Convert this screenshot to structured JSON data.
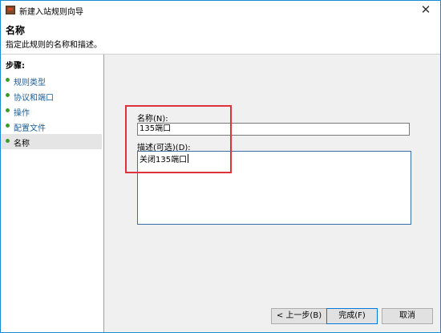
{
  "window": {
    "title": "新建入站规则向导",
    "close_symbol": "✕"
  },
  "header": {
    "title": "名称",
    "description": "指定此规则的名称和描述。"
  },
  "sidebar": {
    "steps_label": "步骤:",
    "items": [
      {
        "label": "规则类型"
      },
      {
        "label": "协议和端口"
      },
      {
        "label": "操作"
      },
      {
        "label": "配置文件"
      },
      {
        "label": "名称"
      }
    ],
    "current_index": 4
  },
  "form": {
    "name_label": "名称(N):",
    "name_value": "135端口",
    "description_label": "描述(可选)(D):",
    "description_value": "关闭135端口"
  },
  "buttons": {
    "back": "< 上一步(B)",
    "finish": "完成(F)",
    "cancel": "取消"
  },
  "colors": {
    "window_border": "#1a8ad4",
    "step_bullet": "#3c9e2a",
    "step_link": "#1a5f9a",
    "annotation": "#e0323a"
  }
}
